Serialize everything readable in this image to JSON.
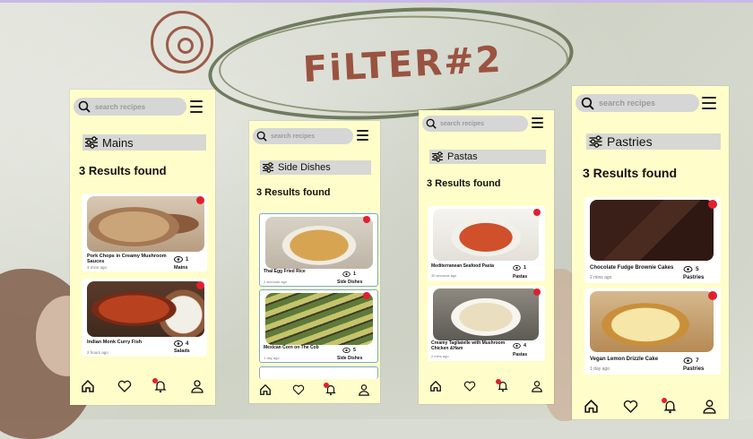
{
  "page_title": "FiLTER#2",
  "colors": {
    "phone_bg": "#fffdc9",
    "heart": "#e0202e",
    "title": "#9a5340",
    "search_bg": "#d6d6d6"
  },
  "search_placeholder": "search recipes",
  "nav_icons": [
    "home-icon",
    "heart-icon",
    "bell-icon",
    "user-icon"
  ],
  "screens": [
    {
      "filter": "Mains",
      "results": "3 Results found",
      "cards": [
        {
          "name": "Pork Chops in Creamy Mushroom Sauces",
          "time": "3 mins ago",
          "views": "1",
          "category": "Mains",
          "image": "porkchop"
        },
        {
          "name": "Indian Monk Curry Fish",
          "time": "2 hours ago",
          "views": "4",
          "category": "Salads",
          "image": "curryfish"
        }
      ]
    },
    {
      "filter": "Side Dishes",
      "results": "3 Results found",
      "cards": [
        {
          "name": "Thai Egg Fried Rice",
          "time": "2 seconds ago",
          "views": "1",
          "category": "Side Dishes",
          "image": "rice"
        },
        {
          "name": "Mexican Corn on The Cob",
          "time": "1 day ago",
          "views": "5",
          "category": "Side Dishes",
          "image": "corn"
        }
      ]
    },
    {
      "filter": "Pastas",
      "results": "3 Results found",
      "cards": [
        {
          "name": "Mediterranean Seafood Pasta",
          "time": "30 seconds ago",
          "views": "1",
          "category": "Pastas",
          "image": "pasta"
        },
        {
          "name": "Creamy Tagliatelle with Mushroom Chicken &Ham",
          "time": "2 mins ago",
          "views": "4",
          "category": "Pastas",
          "image": "tagliatelle"
        }
      ]
    },
    {
      "filter": "Pastries",
      "results": "3 Results found",
      "cards": [
        {
          "name": "Chocolate Fudge Brownie Cakes",
          "time": "2 mins ago",
          "views": "5",
          "category": "Pastries",
          "image": "brownie"
        },
        {
          "name": "Vegan Lemon Drizzle Cake",
          "time": "1 day ago",
          "views": "7",
          "category": "Pastries",
          "image": "cake"
        }
      ]
    }
  ]
}
